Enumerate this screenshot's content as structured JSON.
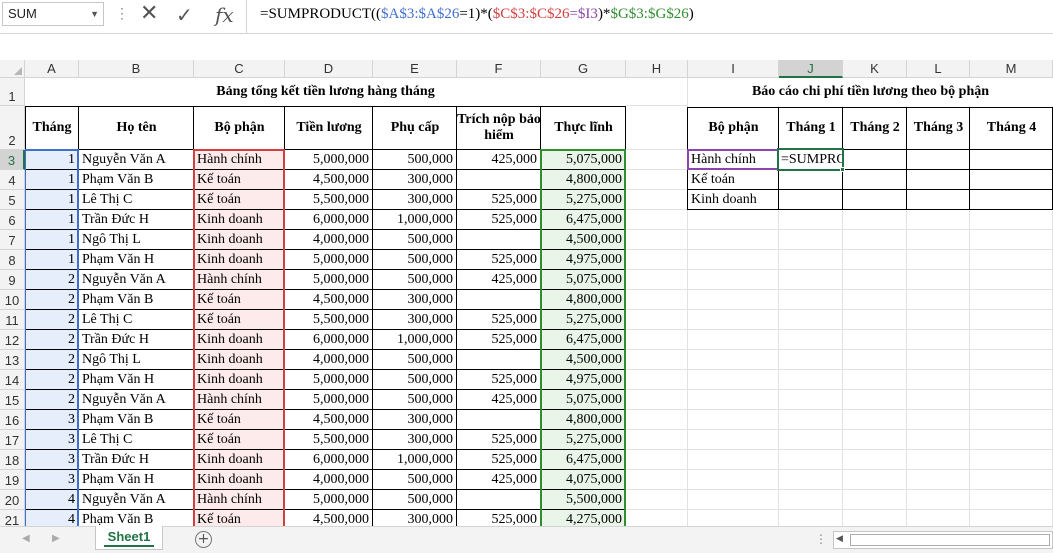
{
  "formula_bar": {
    "name_box": "SUM",
    "formula_parts": [
      {
        "text": "=SUMPRODUCT((",
        "color": ""
      },
      {
        "text": "$A$3:$A$26",
        "color": "blue"
      },
      {
        "text": "=1)*(",
        "color": ""
      },
      {
        "text": "$C$3:$C$26",
        "color": "red"
      },
      {
        "text": "=$I3",
        "color": "purple"
      },
      {
        "text": ")*",
        "color": ""
      },
      {
        "text": "$G$3:$G$26",
        "color": "green"
      },
      {
        "text": ")",
        "color": ""
      }
    ],
    "fx_label": "fx"
  },
  "colors": {
    "header_bg": "#f3f3f3",
    "gridline": "#e1e1e1",
    "accent": "#217346",
    "ref_blue": "#3f6fd0",
    "ref_red": "#d33f3f",
    "ref_green": "#2f8f2f",
    "ref_purple": "#8e44ad",
    "fill_blue": "#e6eefb",
    "fill_red": "#fdeaea",
    "fill_green": "#e9f5e9"
  },
  "columns": [
    "A",
    "B",
    "C",
    "D",
    "E",
    "F",
    "G",
    "H",
    "I",
    "J",
    "K",
    "L",
    "M"
  ],
  "rows": [
    "1",
    "2",
    "3",
    "4",
    "5",
    "6",
    "7",
    "8",
    "9",
    "10",
    "11",
    "12",
    "13",
    "14",
    "15",
    "16",
    "17",
    "18",
    "19",
    "20",
    "21"
  ],
  "selected_column": "J",
  "selected_row": "3",
  "main_table": {
    "title": "Bảng tổng kết tiền lương hàng tháng",
    "headers": [
      "Tháng",
      "Họ tên",
      "Bộ phận",
      "Tiền lương",
      "Phụ cấp",
      "Trích nộp bảo hiểm",
      "Thực lĩnh"
    ],
    "rows": [
      [
        "1",
        "Nguyễn Văn A",
        "Hành chính",
        "5,000,000",
        "500,000",
        "425,000",
        "5,075,000"
      ],
      [
        "1",
        "Phạm Văn B",
        "Kế toán",
        "4,500,000",
        "300,000",
        "",
        "4,800,000"
      ],
      [
        "1",
        "Lê Thị C",
        "Kế toán",
        "5,500,000",
        "300,000",
        "525,000",
        "5,275,000"
      ],
      [
        "1",
        "Trần Đức H",
        "Kinh doanh",
        "6,000,000",
        "1,000,000",
        "525,000",
        "6,475,000"
      ],
      [
        "1",
        "Ngô Thị L",
        "Kinh doanh",
        "4,000,000",
        "500,000",
        "",
        "4,500,000"
      ],
      [
        "1",
        "Phạm Văn H",
        "Kinh doanh",
        "5,000,000",
        "500,000",
        "525,000",
        "4,975,000"
      ],
      [
        "2",
        "Nguyễn Văn A",
        "Hành chính",
        "5,000,000",
        "500,000",
        "425,000",
        "5,075,000"
      ],
      [
        "2",
        "Phạm Văn B",
        "Kế toán",
        "4,500,000",
        "300,000",
        "",
        "4,800,000"
      ],
      [
        "2",
        "Lê Thị C",
        "Kế toán",
        "5,500,000",
        "300,000",
        "525,000",
        "5,275,000"
      ],
      [
        "2",
        "Trần Đức H",
        "Kinh doanh",
        "6,000,000",
        "1,000,000",
        "525,000",
        "6,475,000"
      ],
      [
        "2",
        "Ngô Thị L",
        "Kinh doanh",
        "4,000,000",
        "500,000",
        "",
        "4,500,000"
      ],
      [
        "2",
        "Phạm Văn H",
        "Kinh doanh",
        "5,000,000",
        "500,000",
        "525,000",
        "4,975,000"
      ],
      [
        "2",
        "Nguyễn Văn A",
        "Hành chính",
        "5,000,000",
        "500,000",
        "425,000",
        "5,075,000"
      ],
      [
        "3",
        "Phạm Văn B",
        "Kế toán",
        "4,500,000",
        "300,000",
        "",
        "4,800,000"
      ],
      [
        "3",
        "Lê Thị C",
        "Kế toán",
        "5,500,000",
        "300,000",
        "525,000",
        "5,275,000"
      ],
      [
        "3",
        "Trần Đức H",
        "Kinh doanh",
        "6,000,000",
        "1,000,000",
        "525,000",
        "6,475,000"
      ],
      [
        "3",
        "Phạm Văn H",
        "Kinh doanh",
        "4,000,000",
        "500,000",
        "425,000",
        "4,075,000"
      ],
      [
        "4",
        "Nguyễn Văn A",
        "Hành chính",
        "5,000,000",
        "500,000",
        "",
        "5,500,000"
      ],
      [
        "4",
        "Phạm Văn B",
        "Kế toán",
        "4,500,000",
        "300,000",
        "525,000",
        "4,275,000"
      ]
    ]
  },
  "report_table": {
    "title": "Báo cáo chi phí tiền lương theo bộ phận",
    "headers": [
      "Bộ phận",
      "Tháng 1",
      "Tháng 2",
      "Tháng 3",
      "Tháng 4"
    ],
    "departments": [
      "Hành chính",
      "Kế toán",
      "Kinh doanh"
    ],
    "active_cell_text": "=SUMPRODUCT("
  },
  "sheet_tabs": {
    "active": "Sheet1",
    "add_label": "+"
  }
}
